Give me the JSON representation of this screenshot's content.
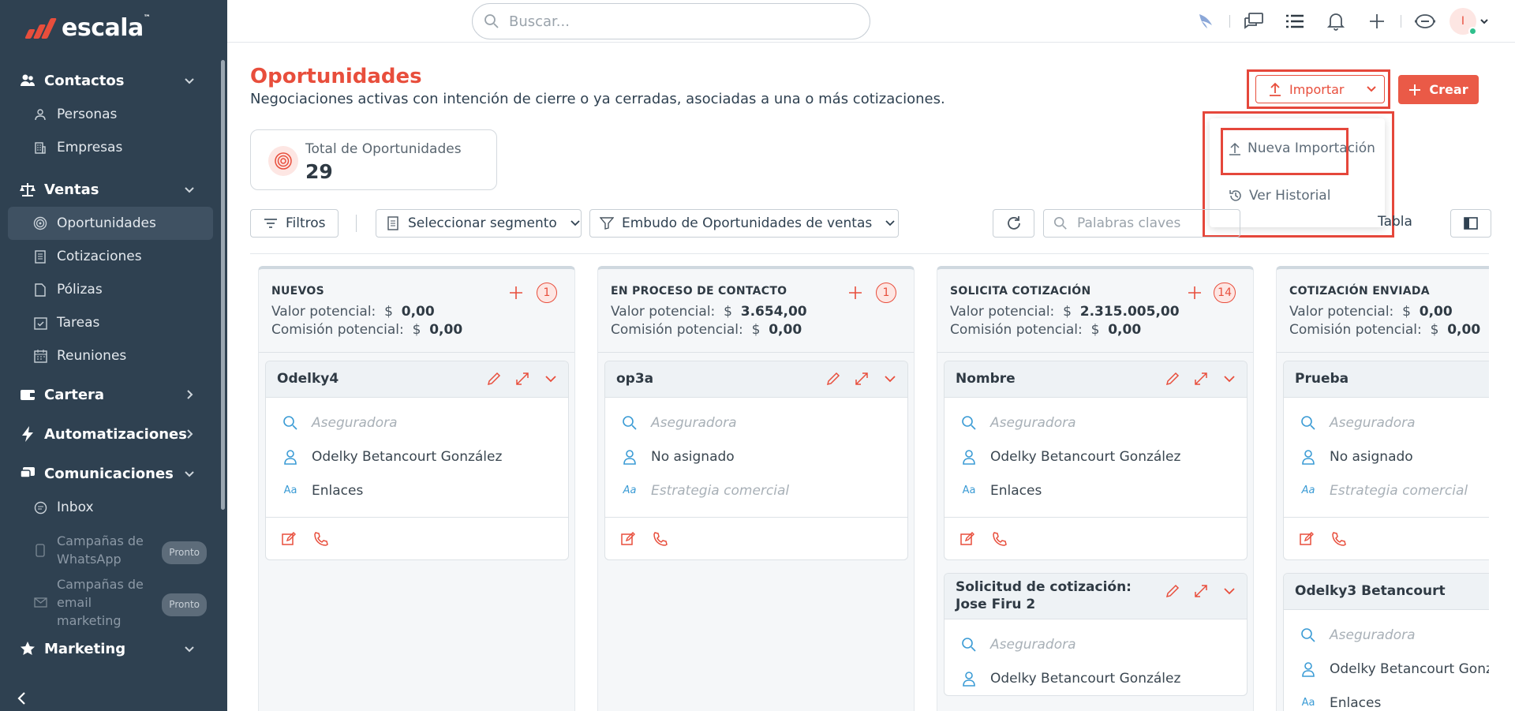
{
  "brand": {
    "name": "escala",
    "tm": "™"
  },
  "sidebar": {
    "sections": [
      {
        "label": "Contactos",
        "icon": "users-icon",
        "expanded": true
      },
      {
        "label": "Ventas",
        "icon": "scale-icon",
        "expanded": true
      },
      {
        "label": "Cartera",
        "icon": "wallet-icon",
        "expanded": false
      },
      {
        "label": "Automatizaciones",
        "icon": "bolt-icon",
        "expanded": false
      },
      {
        "label": "Comunicaciones",
        "icon": "chat-icon",
        "expanded": true
      },
      {
        "label": "Marketing",
        "icon": "star-icon",
        "expanded": true
      }
    ],
    "contactos_items": [
      "Personas",
      "Empresas"
    ],
    "ventas_items": [
      "Oportunidades",
      "Cotizaciones",
      "Pólizas",
      "Tareas",
      "Reuniones"
    ],
    "comunicaciones_items": [
      "Inbox"
    ],
    "disabled_items": [
      "Campañas de WhatsApp",
      "Campañas de email marketing"
    ],
    "pronto_label": "Pronto"
  },
  "topbar": {
    "search_placeholder": "Buscar...",
    "avatar_initial": "I"
  },
  "header": {
    "title": "Oportunidades",
    "subtitle": "Negociaciones activas con intención de cierre o ya cerradas, asociadas a una o más cotizaciones.",
    "import_label": "Importar",
    "create_label": "Crear"
  },
  "import_menu": {
    "items": [
      "Nueva Importación",
      "Ver Historial"
    ]
  },
  "stat": {
    "label": "Total de Oportunidades",
    "value": "29"
  },
  "filters": {
    "filtros": "Filtros",
    "segment": "Seleccionar segmento",
    "funnel": "Embudo de Oportunidades de ventas",
    "keywords_placeholder": "Palabras claves",
    "view_label": "Tabla"
  },
  "labels": {
    "valor": "Valor potencial:",
    "comision": "Comisión potencial:",
    "currency": "$"
  },
  "columns": [
    {
      "title": "NUEVOS",
      "count": "1",
      "valor": "0,00",
      "comision": "0,00",
      "cards": [
        {
          "title": "Odelky4",
          "aseguradora": "Aseguradora",
          "owner": "Odelky Betancourt González",
          "estrategia": "Enlaces",
          "owner_ph": false,
          "estrategia_ph": false
        }
      ]
    },
    {
      "title": "EN PROCESO DE CONTACTO",
      "count": "1",
      "valor": "3.654,00",
      "comision": "0,00",
      "cards": [
        {
          "title": "op3a",
          "aseguradora": "Aseguradora",
          "owner": "No asignado",
          "estrategia": "Estrategia comercial",
          "owner_ph": false,
          "estrategia_ph": true
        }
      ]
    },
    {
      "title": "SOLICITA COTIZACIÓN",
      "count": "14",
      "valor": "2.315.005,00",
      "comision": "0,00",
      "cards": [
        {
          "title": "Nombre",
          "aseguradora": "Aseguradora",
          "owner": "Odelky Betancourt González",
          "estrategia": "Enlaces",
          "owner_ph": false,
          "estrategia_ph": false
        },
        {
          "title": "Solicitud de cotización: Jose Firu 2",
          "aseguradora": "Aseguradora",
          "owner": "Odelky Betancourt González"
        }
      ]
    },
    {
      "title": "COTIZACIÓN ENVIADA",
      "count": "",
      "valor": "0,00",
      "comision": "0,00",
      "cards": [
        {
          "title": "Prueba",
          "aseguradora": "Aseguradora",
          "owner": "No asignado",
          "estrategia": "Estrategia comercial",
          "owner_ph": false,
          "estrategia_ph": true
        },
        {
          "title": "Odelky3 Betancourt",
          "aseguradora": "Aseguradora",
          "owner": "Odelky Betancourt Gonz",
          "estrategia": "Enlaces"
        }
      ]
    }
  ],
  "colors": {
    "accent": "#e84e3c",
    "sidebar": "#2f4151",
    "icon_blue": "#3a9bd5"
  }
}
